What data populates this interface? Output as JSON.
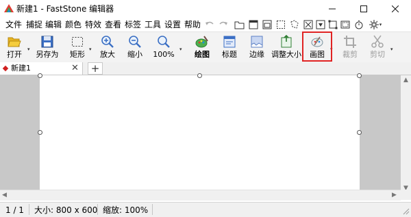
{
  "window": {
    "title": "新建1 - FastStone 编辑器"
  },
  "menu": [
    "文件",
    "捕捉",
    "编辑",
    "颜色",
    "特效",
    "查看",
    "标签",
    "工具",
    "设置",
    "帮助"
  ],
  "menu_icons": [
    "undo-icon",
    "redo-icon",
    "open-folder-icon",
    "fullscreen-icon",
    "window-icon",
    "rect-region-icon",
    "freehand-region-icon",
    "fullscreen-capture-icon",
    "scrolling-capture-icon",
    "fixed-region-icon",
    "video-capture-icon",
    "timer-icon",
    "settings-gear-icon"
  ],
  "toolbar": {
    "open": "打开",
    "save_as": "另存为",
    "rectangle": "矩形",
    "zoom_in": "放大",
    "zoom_out": "缩小",
    "zoom_level": "100%",
    "draw": "绘图",
    "caption": "标题",
    "edge": "边缘",
    "resize": "调整大小",
    "paint": "画图",
    "crop": "裁剪",
    "cut": "剪切"
  },
  "tabs": {
    "doc_label": "新建1",
    "close": "✕",
    "add": "+"
  },
  "status": {
    "page": "1 / 1",
    "size": "大小: 800 x 600",
    "zoom": "缩放: 100%"
  },
  "colors": {
    "highlight": "#e02222",
    "workarea": "#c8c8c8",
    "toolbar_bg": "#f3f3f3"
  }
}
